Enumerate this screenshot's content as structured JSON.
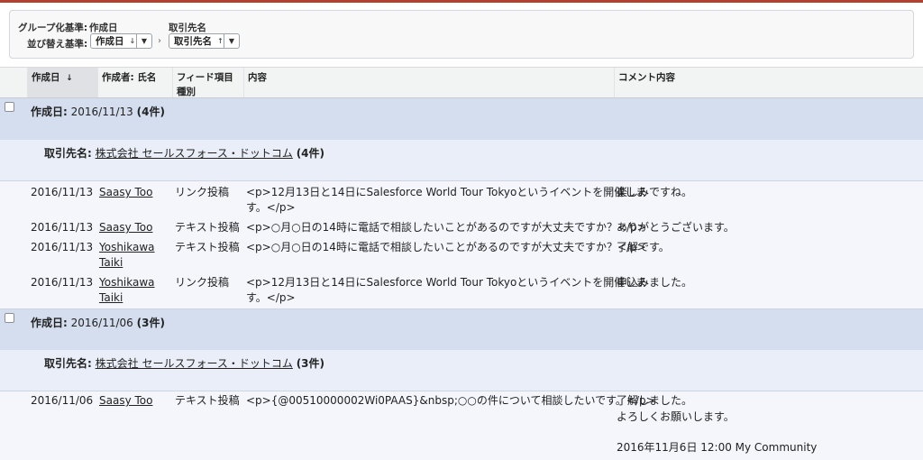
{
  "grouping": {
    "group_label": "グループ化基準:",
    "group_value": "作成日",
    "sort_label": "並び替え基準:",
    "secondary_header": "取引先名",
    "sort1": {
      "value": "作成日",
      "sort_glyph": "↓"
    },
    "sort2": {
      "value": "取引先名",
      "sort_glyph": "↑"
    }
  },
  "table": {
    "columns": [
      "作成日",
      "作成者: 氏名",
      "フィード項目種別",
      "内容",
      "コメント内容"
    ],
    "sort_indicator": "↓"
  },
  "groups": [
    {
      "label": "作成日:",
      "value": "2016/11/13",
      "count": "(4件)",
      "sub": {
        "label": "取引先名:",
        "account": "株式会社 セールスフォース・ドットコム",
        "count": "(4件)"
      },
      "rows": [
        {
          "date": "2016/11/13",
          "author": [
            "Saasy Too"
          ],
          "type": "リンク投稿",
          "content": [
            "<p>12月13日と14日にSalesforce World Tour Tokyoというイベントを開催しま",
            "す。</p>"
          ],
          "comment": [
            "楽しみですね。"
          ]
        },
        {
          "date": "2016/11/13",
          "author": [
            "Saasy Too"
          ],
          "type": "テキスト投稿",
          "content": [
            "<p>○月○日の14時に電話で相談したいことがあるのですが大丈夫ですか？</p>"
          ],
          "comment": [
            "ありがとうございます。"
          ]
        },
        {
          "date": "2016/11/13",
          "author": [
            "Yoshikawa",
            "Taiki"
          ],
          "type": "テキスト投稿",
          "content": [
            "<p>○月○日の14時に電話で相談したいことがあるのですが大丈夫ですか？</p>"
          ],
          "comment": [
            "了解です。"
          ]
        },
        {
          "date": "2016/11/13",
          "author": [
            "Yoshikawa",
            "Taiki"
          ],
          "type": "リンク投稿",
          "content": [
            "<p>12月13日と14日にSalesforce World Tour Tokyoというイベントを開催しま",
            "す。</p>"
          ],
          "comment": [
            "申込みました。"
          ]
        }
      ]
    },
    {
      "label": "作成日:",
      "value": "2016/11/06",
      "count": "(3件)",
      "sub": {
        "label": "取引先名:",
        "account": "株式会社 セールスフォース・ドットコム",
        "count": "(3件)"
      },
      "rows": [
        {
          "date": "2016/11/06",
          "author": [
            "Saasy Too"
          ],
          "type": "テキスト投稿",
          "content": [
            "<p>{@00510000002Wi0PAAS}&nbsp;○○の件について相談したいです。</p>"
          ],
          "comment": [
            "了解しました。",
            "よろしくお願いします。",
            "",
            "2016年11月6日 12:00 My Community"
          ]
        }
      ]
    }
  ]
}
